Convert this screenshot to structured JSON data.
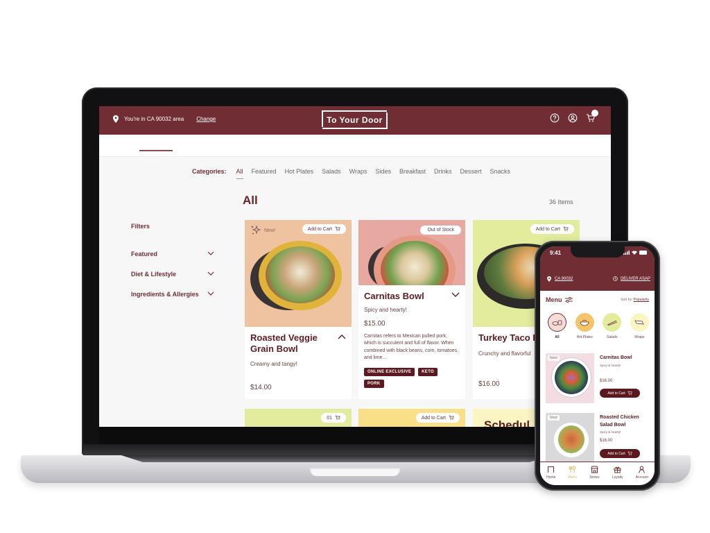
{
  "colors": {
    "brand": "#702d33",
    "brand_dark": "#5c1a20",
    "accent_gold": "#e3b55b",
    "card_peach": "#f0c3a0",
    "card_pink": "#e8a8a2",
    "card_lime": "#e2ec9c",
    "card_yellow": "#f9df87",
    "card_cream": "#fbf5c4"
  },
  "desktop": {
    "topbar": {
      "location_text": "You're in CA 90032 area",
      "change_link": "Change",
      "logo": "To Your Door",
      "icons": [
        "help-icon",
        "account-icon",
        "cart-icon"
      ]
    },
    "categories": {
      "label": "Categories:",
      "items": [
        "All",
        "Featured",
        "Hot Plates",
        "Salads",
        "Wraps",
        "Sides",
        "Breakfast",
        "Drinks",
        "Dessert",
        "Snacks"
      ],
      "active": "All"
    },
    "section_title": "All",
    "item_count": "36 Items",
    "filters": {
      "title": "Filters",
      "groups": [
        "Featured",
        "Diet & Lifestyle",
        "Ingredients & Allergies"
      ]
    },
    "products": [
      {
        "name": "Roasted Veggie Grain Bowl",
        "badge": "New!",
        "action": "Add to Cart",
        "description": "Creamy and tangy!",
        "price": "$14.00",
        "expanded": true
      },
      {
        "name": "Carnitas Bowl",
        "action": "Out of Stock",
        "description": "Spicy and hearty!",
        "price": "$15.00",
        "long_description": "Carnitas refers to Mexican pulled pork, which is succulent and full of flavor. When combined with black beans, corn, tomatoes, and lime...",
        "tags": [
          "ONLINE EXCLUSIVE",
          "KETO",
          "PORK"
        ],
        "expanded": false
      },
      {
        "name": "Turkey Taco B",
        "action": "Add to Cart",
        "description": "Crunchy and flavorful",
        "price": "$16.00"
      }
    ],
    "row2": [
      {
        "action": "01"
      },
      {
        "action": "Add to Cart"
      },
      {
        "partial_title": "Schedul"
      }
    ]
  },
  "mobile": {
    "time": "9:41",
    "location": "CA 90032",
    "deliver": "DELIVER ASAP",
    "menu_title": "Menu",
    "sort_label": "Sort by:",
    "sort_value": "Popularity",
    "categories": [
      "All",
      "Hot Plates",
      "Salads",
      "Wraps"
    ],
    "active_category": "All",
    "items": [
      {
        "badge": "New!",
        "name": "Carnitas Bowl",
        "description": "Spicy & hearty!",
        "price": "$16.00",
        "action": "Add to Cart"
      },
      {
        "badge": "New!",
        "name": "Roasted Chicken Salad Bowl",
        "description": "Spicy & hearty!",
        "price": "$16.00",
        "action": "Add to Cart"
      }
    ],
    "tabs": [
      "Home",
      "Menu",
      "Stores",
      "Loyalty",
      "Account"
    ],
    "active_tab": "Menu"
  }
}
